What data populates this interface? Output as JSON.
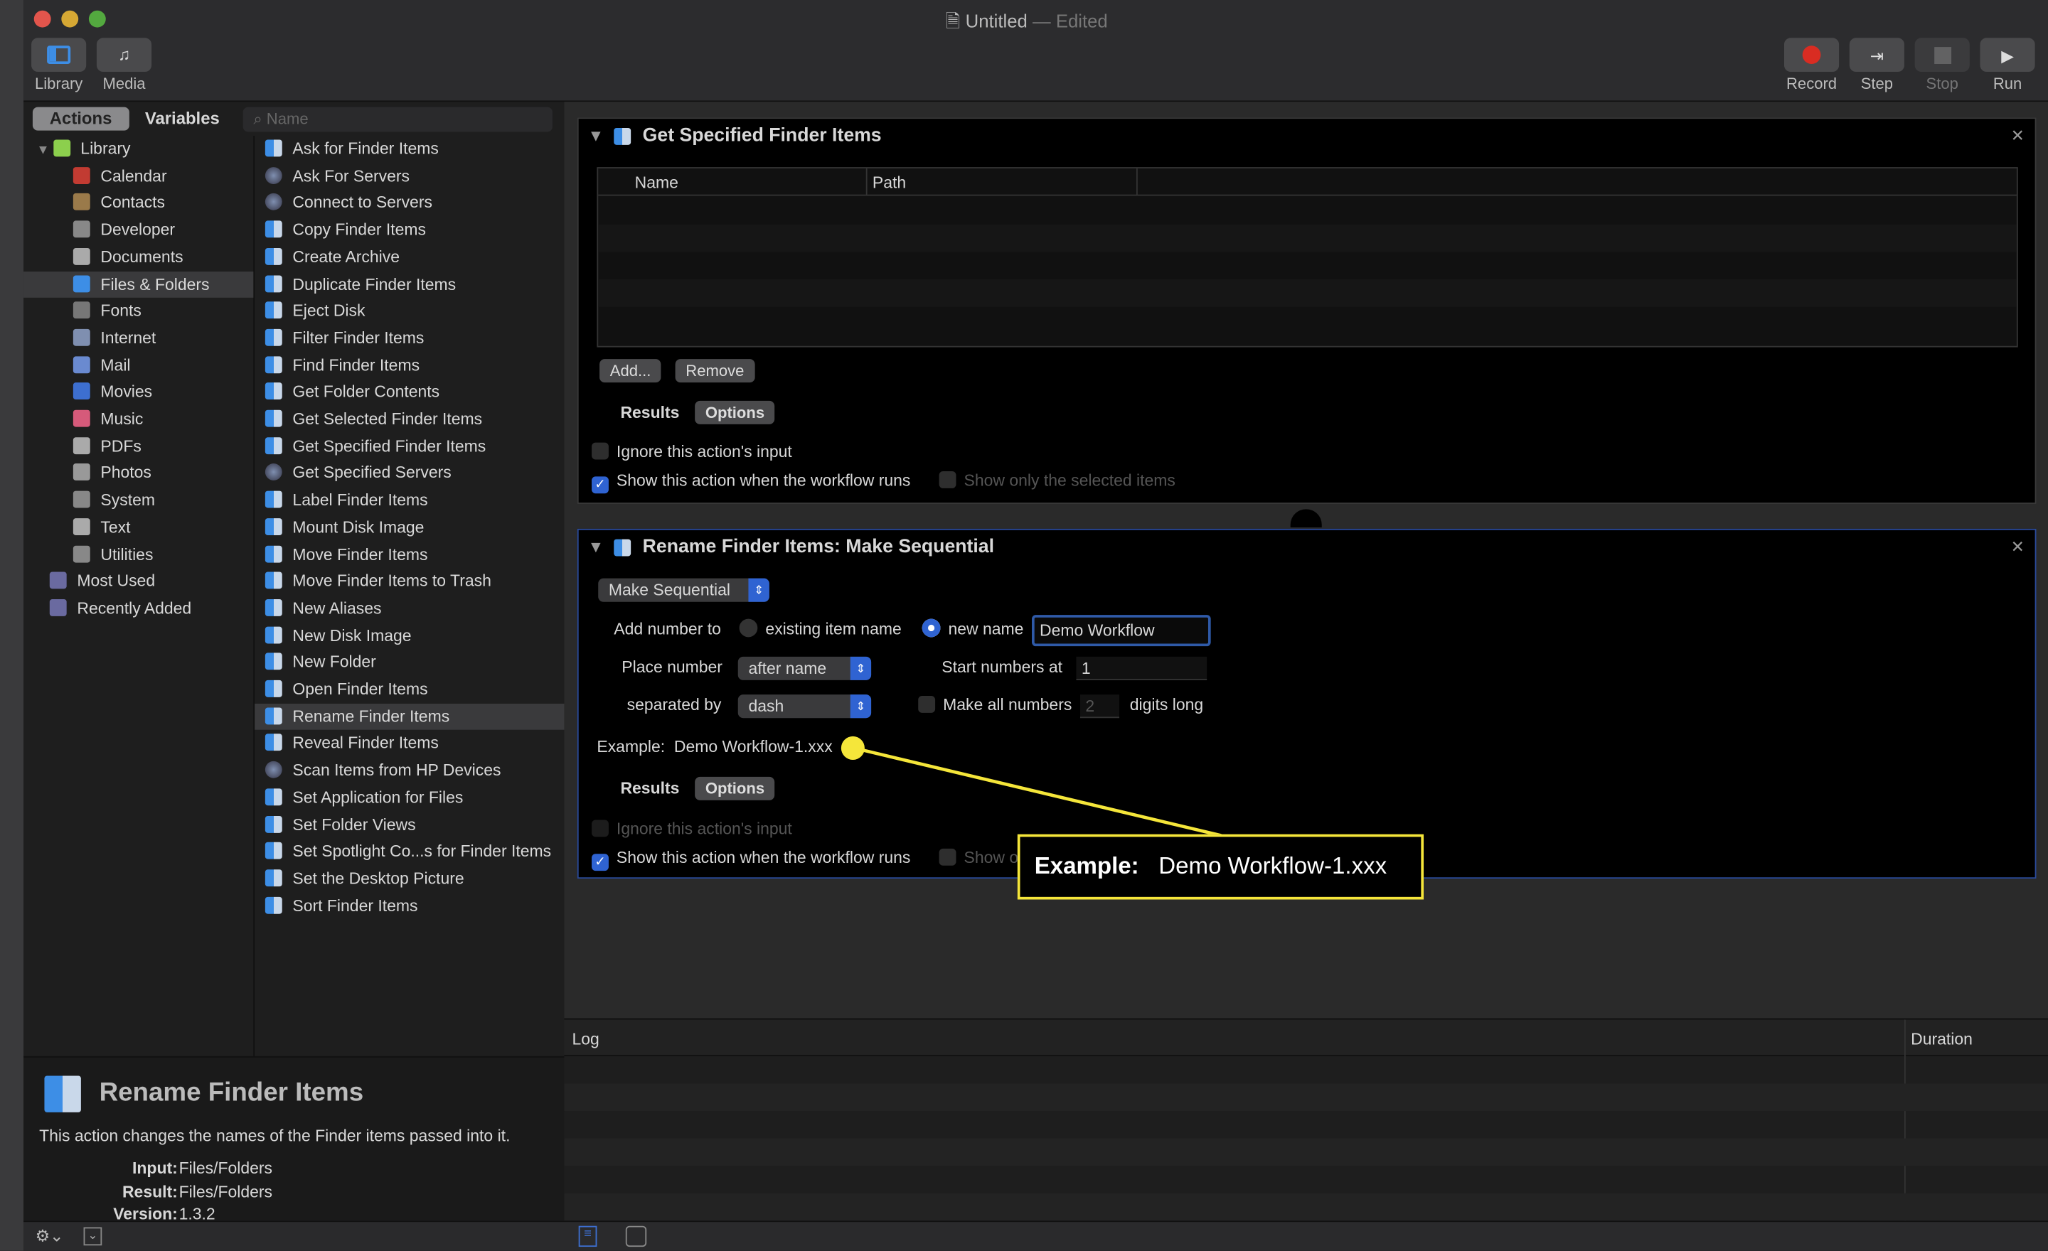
{
  "window": {
    "title": "Untitled",
    "edited": "— Edited"
  },
  "toolbar": {
    "library": "Library",
    "media": "Media",
    "record": "Record",
    "step": "Step",
    "stop": "Stop",
    "run": "Run"
  },
  "tabs": {
    "actions": "Actions",
    "variables": "Variables"
  },
  "search": {
    "placeholder": "Name"
  },
  "categories": [
    {
      "label": "Library",
      "icon": "library-icon"
    },
    {
      "label": "Calendar",
      "icon": "calendar-icon"
    },
    {
      "label": "Contacts",
      "icon": "contacts-icon"
    },
    {
      "label": "Developer",
      "icon": "developer-icon"
    },
    {
      "label": "Documents",
      "icon": "documents-icon"
    },
    {
      "label": "Files & Folders",
      "icon": "finder-icon",
      "selected": true
    },
    {
      "label": "Fonts",
      "icon": "fonts-icon"
    },
    {
      "label": "Internet",
      "icon": "globe-icon"
    },
    {
      "label": "Mail",
      "icon": "mail-icon"
    },
    {
      "label": "Movies",
      "icon": "movies-icon"
    },
    {
      "label": "Music",
      "icon": "music-icon"
    },
    {
      "label": "PDFs",
      "icon": "pdf-icon"
    },
    {
      "label": "Photos",
      "icon": "photos-icon"
    },
    {
      "label": "System",
      "icon": "system-icon"
    },
    {
      "label": "Text",
      "icon": "text-icon"
    },
    {
      "label": "Utilities",
      "icon": "utilities-icon"
    },
    {
      "label": "Most Used",
      "icon": "smart-folder-icon"
    },
    {
      "label": "Recently Added",
      "icon": "smart-folder-icon"
    }
  ],
  "actions": [
    "Ask for Finder Items",
    "Ask For Servers",
    "Connect to Servers",
    "Copy Finder Items",
    "Create Archive",
    "Duplicate Finder Items",
    "Eject Disk",
    "Filter Finder Items",
    "Find Finder Items",
    "Get Folder Contents",
    "Get Selected Finder Items",
    "Get Specified Finder Items",
    "Get Specified Servers",
    "Label Finder Items",
    "Mount Disk Image",
    "Move Finder Items",
    "Move Finder Items to Trash",
    "New Aliases",
    "New Disk Image",
    "New Folder",
    "Open Finder Items",
    "Rename Finder Items",
    "Reveal Finder Items",
    "Scan Items from HP Devices",
    "Set Application for Files",
    "Set Folder Views",
    "Set Spotlight Co...s for Finder Items",
    "Set the Desktop Picture",
    "Sort Finder Items"
  ],
  "selected_action": "Rename Finder Items",
  "description": {
    "title": "Rename Finder Items",
    "text": "This action changes the names of the Finder items passed into it.",
    "input_label": "Input:",
    "input": "Files/Folders",
    "result_label": "Result:",
    "result": "Files/Folders",
    "version_label": "Version:",
    "version": "1.3.2"
  },
  "card1": {
    "title": "Get Specified Finder Items",
    "col_name": "Name",
    "col_path": "Path",
    "add": "Add...",
    "remove": "Remove",
    "results": "Results",
    "options": "Options",
    "ignore": "Ignore this action's input",
    "show": "Show this action when the workflow runs",
    "show_selected": "Show only the selected items"
  },
  "card2": {
    "title": "Rename Finder Items: Make Sequential",
    "mode": "Make Sequential",
    "add_number_to": "Add number to",
    "existing": "existing item name",
    "new_name_label": "new name",
    "new_name": "Demo Workflow",
    "place_number": "Place number",
    "place_value": "after name",
    "start_label": "Start numbers at",
    "start": "1",
    "separated_by": "separated by",
    "separator": "dash",
    "make_all": "Make all numbers",
    "digits": "2",
    "digits_long": "digits long",
    "example_label": "Example:",
    "example": "Demo Workflow-1.xxx",
    "results": "Results",
    "options": "Options",
    "ignore": "Ignore this action's input",
    "show": "Show this action when the workflow runs",
    "show_partial": "Show o"
  },
  "callout": {
    "label": "Example:",
    "value": "Demo Workflow-1.xxx",
    "color": "#f5e63a"
  },
  "log": {
    "log": "Log",
    "duration": "Duration"
  },
  "colors": {
    "accent": "#2f63d2",
    "background": "#1e1e1e"
  }
}
